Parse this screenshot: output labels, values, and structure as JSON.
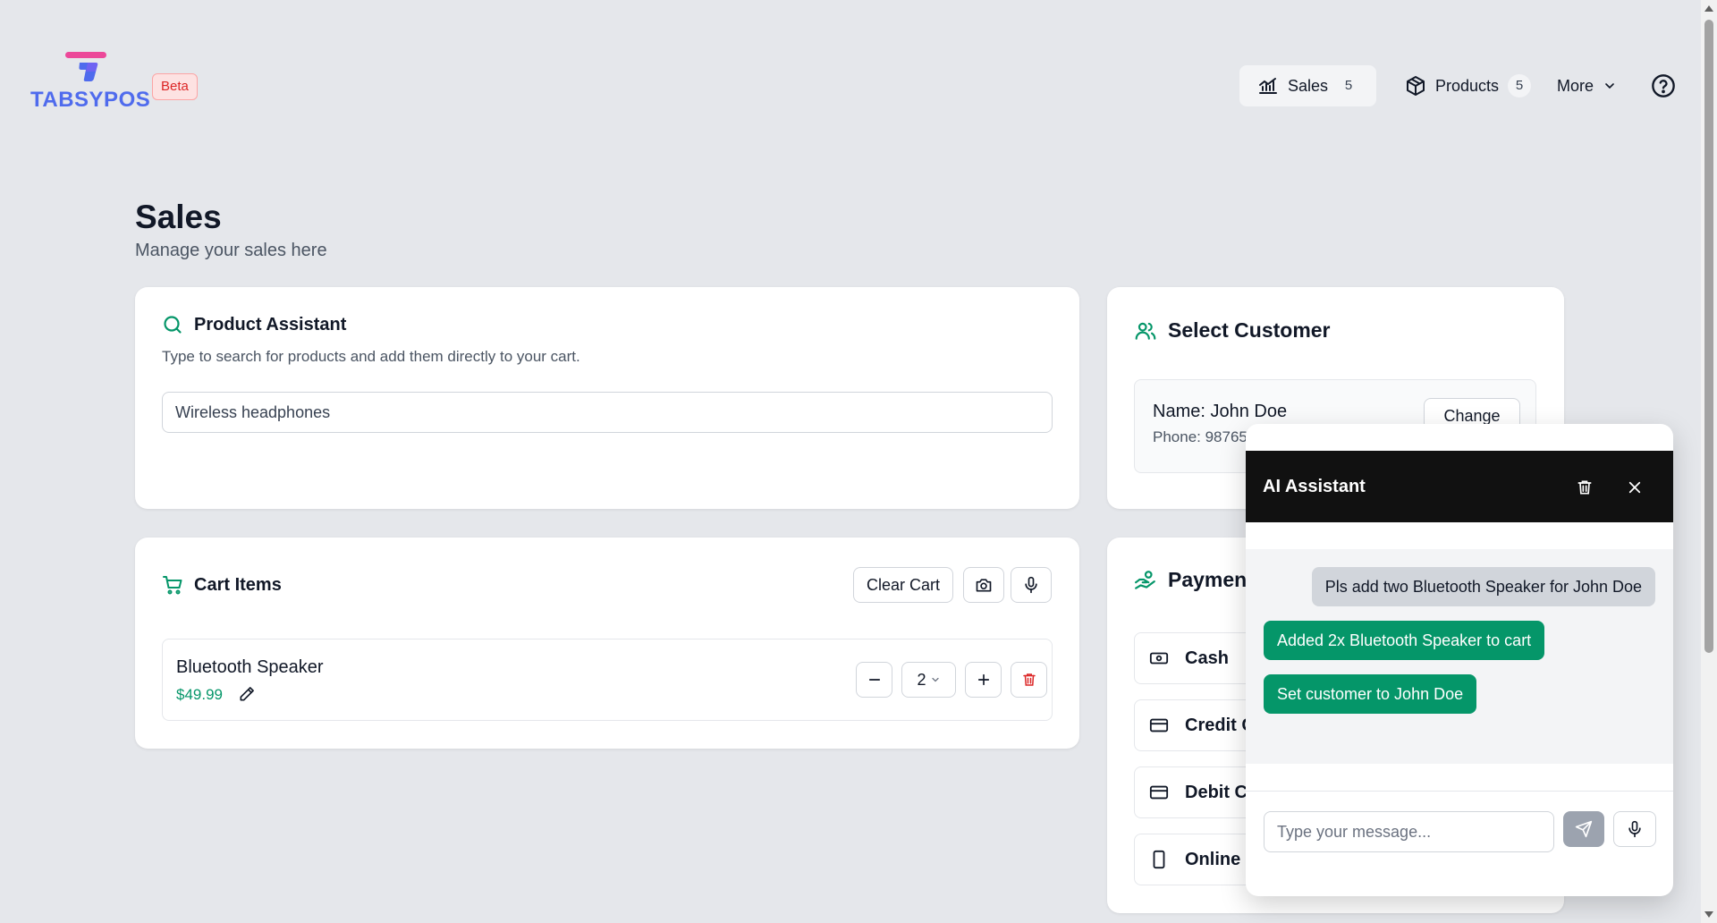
{
  "brand": {
    "name": "TABSYPOS",
    "badge": "Beta"
  },
  "nav": {
    "sales": {
      "label": "Sales",
      "count": "5"
    },
    "products": {
      "label": "Products",
      "count": "5"
    },
    "more": {
      "label": "More"
    }
  },
  "page": {
    "title": "Sales",
    "subtitle": "Manage your sales here"
  },
  "product_assistant": {
    "title": "Product Assistant",
    "description": "Type to search for products and add them directly to your cart.",
    "input_value": "Wireless headphones"
  },
  "cart": {
    "title": "Cart Items",
    "clear_label": "Clear Cart",
    "items": [
      {
        "name": "Bluetooth Speaker",
        "price": "$49.99",
        "quantity": "2"
      }
    ]
  },
  "customer": {
    "title": "Select Customer",
    "name_line": "Name: John Doe",
    "phone_line": "Phone: 98765",
    "change_label": "Change"
  },
  "payment": {
    "title": "Payment",
    "options": [
      "Cash",
      "Credit C",
      "Debit Ca",
      "Online"
    ]
  },
  "ai_assistant": {
    "title": "AI Assistant",
    "messages": [
      {
        "role": "user",
        "text": "Pls add two Bluetooth Speaker for John Doe"
      },
      {
        "role": "assistant",
        "text": "Added 2x Bluetooth Speaker to cart"
      },
      {
        "role": "assistant",
        "text": "Set customer to John Doe"
      }
    ],
    "input_placeholder": "Type your message..."
  },
  "colors": {
    "background": "#e5e7eb",
    "accent": "#059669",
    "brand_blue": "#4f6bed",
    "brand_pink": "#ec4899",
    "danger": "#dc2626",
    "ai_header": "#111111"
  }
}
